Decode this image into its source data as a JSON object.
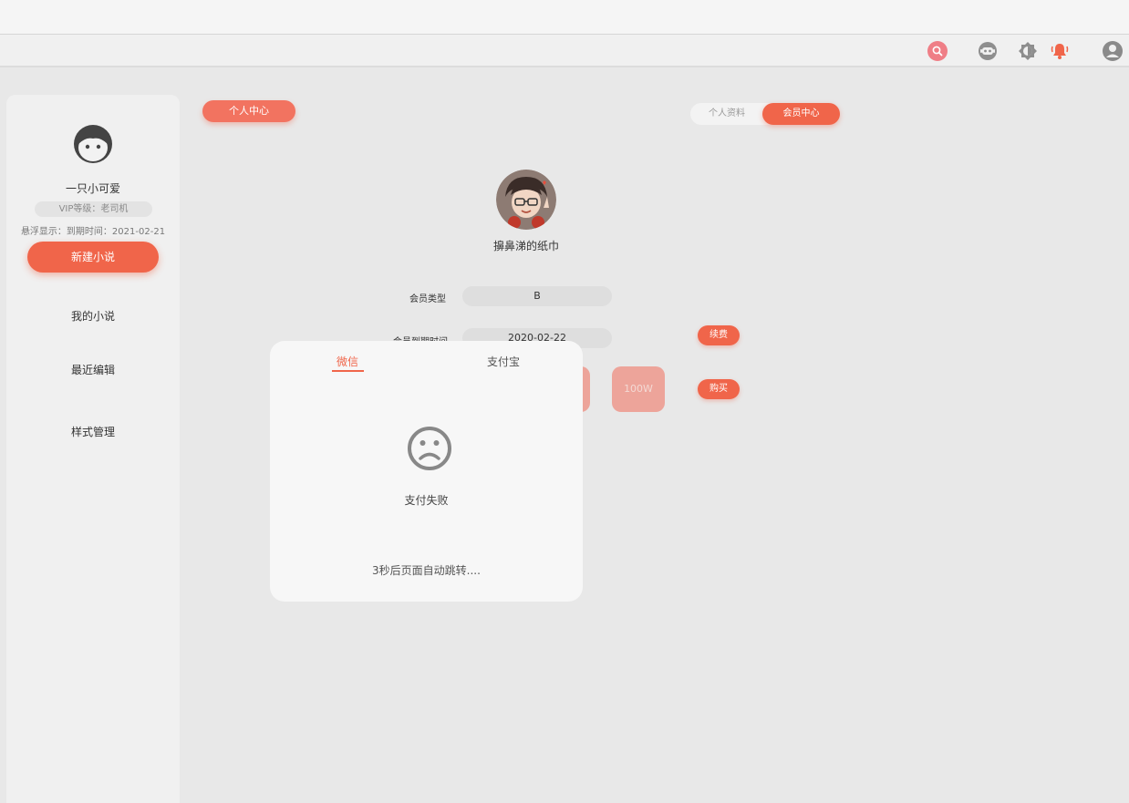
{
  "colors": {
    "accent": "#f0654a",
    "accent_soft": "#eda49a",
    "background": "#e8e8e8",
    "sidebar": "#f0f0f0"
  },
  "toolbar": {
    "icons": [
      "search-icon",
      "robot-icon",
      "theme-icon",
      "bell-icon",
      "user-icon"
    ]
  },
  "sidebar": {
    "user_name": "一只小可爱",
    "vip_level": "VIP等级：老司机",
    "expire_hint": "悬浮显示：到期时间：2021-02-21",
    "new_button": "新建小说",
    "items": [
      {
        "label": "我的小说"
      },
      {
        "label": "最近编辑"
      },
      {
        "label": "样式管理"
      }
    ]
  },
  "main": {
    "page_pill": "个人中心",
    "tabs": [
      {
        "label": "个人资料",
        "active": false
      },
      {
        "label": "会员中心",
        "active": true
      }
    ],
    "profile_name": "擤鼻涕的纸巾",
    "fields": {
      "member_type_label": "会员类型",
      "member_type_value": "B",
      "expire_label": "会员到期时间",
      "expire_value": "2020-02-22"
    },
    "renew_button": "续费",
    "buy_button": "购买",
    "plan_card": "100W"
  },
  "modal": {
    "tab_wechat": "微信",
    "tab_alipay": "支付宝",
    "status": "支付失败",
    "redirect": "3秒后页面自动跳转...."
  }
}
